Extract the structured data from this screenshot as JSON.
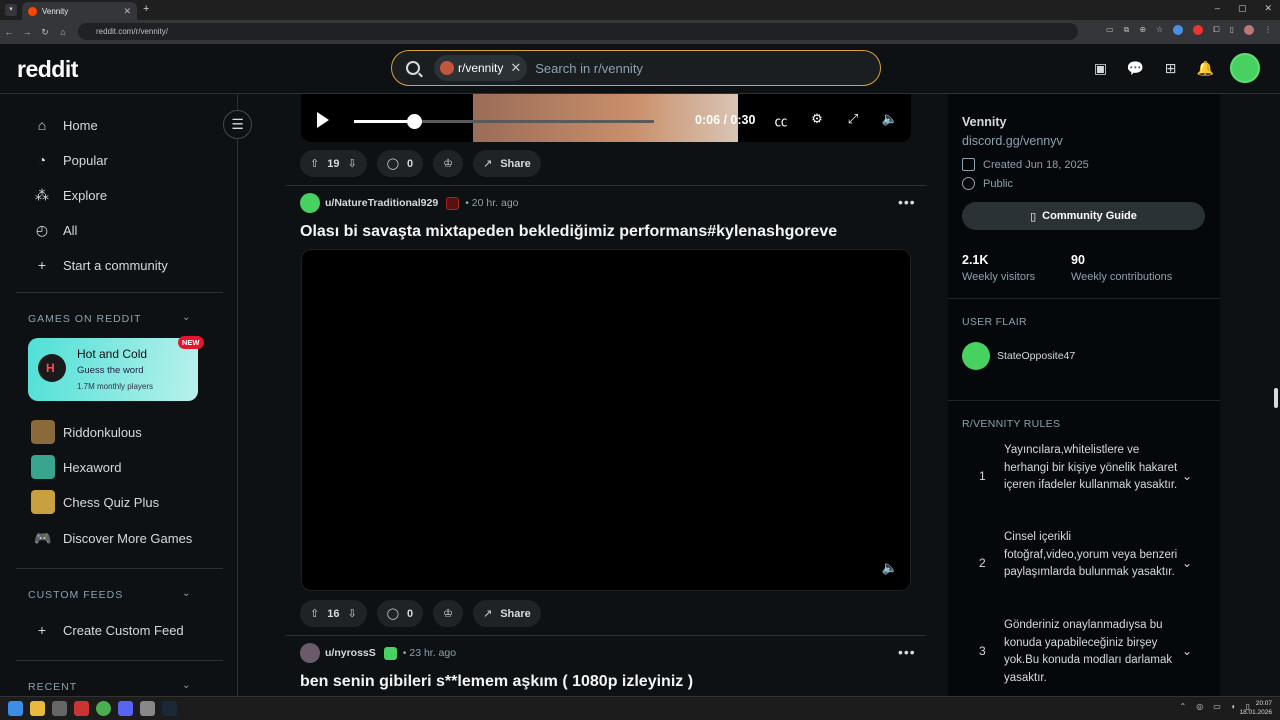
{
  "browser": {
    "tab_title": "Vennity",
    "tab_close": "✕",
    "new_tab": "+",
    "url": "reddit.com/r/vennity/",
    "win_controls": [
      "–",
      "▢",
      "✕"
    ]
  },
  "header": {
    "logo": "reddit",
    "search_chip": "r/vennity",
    "search_placeholder": "Search in r/vennity"
  },
  "sidebar": {
    "nav": [
      {
        "label": "Home",
        "icon": "home-icon"
      },
      {
        "label": "Popular",
        "icon": "popular-icon"
      },
      {
        "label": "Explore",
        "icon": "explore-icon"
      },
      {
        "label": "All",
        "icon": "all-icon"
      },
      {
        "label": "Start a community",
        "icon": "plus-icon"
      }
    ],
    "games_title": "GAMES ON REDDIT",
    "featured_game": {
      "title": "Hot and Cold",
      "subtitle": "Guess the word",
      "players": "1.7M monthly players",
      "badge": "NEW"
    },
    "games": [
      {
        "label": "Riddonkulous"
      },
      {
        "label": "Hexaword"
      },
      {
        "label": "Chess Quiz Plus"
      },
      {
        "label": "Discover More Games"
      }
    ],
    "custom_feeds_title": "CUSTOM FEEDS",
    "create_feed": "Create Custom Feed",
    "recent_title": "RECENT"
  },
  "feed": {
    "player": {
      "time": "0:06 / 0:30",
      "progress": 0.2
    },
    "post1_actions": {
      "votes": "19",
      "comments": "0",
      "share": "Share"
    },
    "post2": {
      "user": "u/NatureTraditional929",
      "time": "• 20 hr. ago",
      "title": "Olası bi savaşta mixtapeden beklediğimiz performans#kylenashgoreve",
      "votes": "16",
      "comments": "0",
      "share": "Share"
    },
    "post3": {
      "user": "u/nyrossS",
      "time": "• 23 hr. ago",
      "title": "ben senin gibileri s**lemem aşkım ( 1080p izleyiniz )"
    },
    "more": "•••"
  },
  "right_panel": {
    "name": "Vennity",
    "link": "discord.gg/vennyv",
    "created": "Created Jun 18, 2025",
    "visibility": "Public",
    "guide_button": "Community Guide",
    "visitors_n": "2.1K",
    "visitors_l": "Weekly visitors",
    "contrib_n": "90",
    "contrib_l": "Weekly contributions",
    "flair_title": "USER FLAIR",
    "flair_user": "StateOpposite47",
    "rules_title": "R/VENNITY RULES",
    "rules": [
      {
        "num": "1",
        "text": "Yayıncılara,whitelistlere ve herhangi bir kişiye yönelik hakaret içeren ifadeler kullanmak yasaktır."
      },
      {
        "num": "2",
        "text": "Cinsel içerikli fotoğraf,video,yorum veya benzeri paylaşımlarda bulunmak yasaktır."
      },
      {
        "num": "3",
        "text": "Gönderiniz onaylanmadıysa bu konuda yapabileceğiniz birşey yok.Bu konuda modları darlamak yasaktır."
      }
    ]
  },
  "taskbar": {
    "time": "20:07",
    "date": "18.01.2026"
  }
}
